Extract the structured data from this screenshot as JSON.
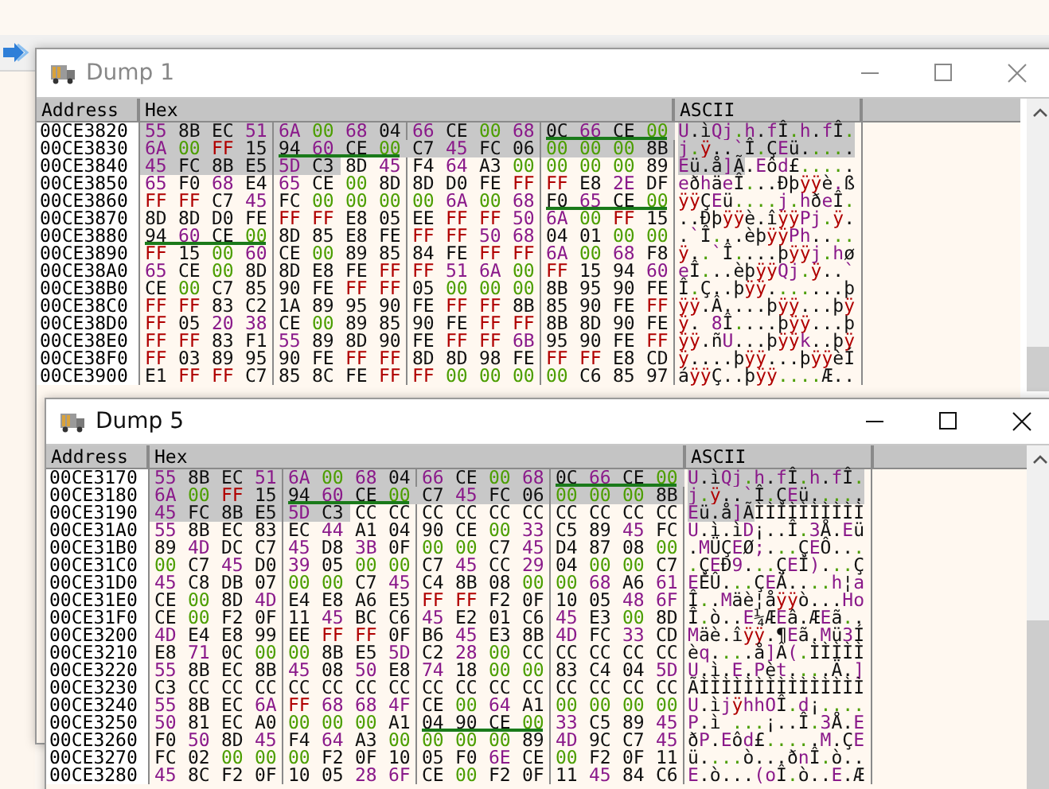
{
  "windows": [
    {
      "title": "Dump 1",
      "active": false,
      "columns": [
        "Address",
        "Hex",
        "ASCII"
      ],
      "rows": [
        {
          "address": "00CE3820",
          "groups": [
            {
              "bytes": "55 8B EC 51",
              "selected": [
                true,
                true,
                true,
                true
              ],
              "underlined": false
            },
            {
              "bytes": "6A 00 68 04",
              "selected": [
                true,
                true,
                true,
                true
              ],
              "underlined": false
            },
            {
              "bytes": "66 CE 00 68",
              "selected": [
                true,
                true,
                true,
                true
              ],
              "underlined": false
            },
            {
              "bytes": "0C 66 CE 00",
              "selected": [
                true,
                true,
                true,
                true
              ],
              "underlined": true
            }
          ],
          "ascii": [
            {
              "text": "U.ìQj.h.fÎ.h.fÎ.",
              "selected": true
            }
          ]
        },
        {
          "address": "00CE3830",
          "groups": [
            {
              "bytes": "6A 00 FF 15",
              "selected": [
                true,
                true,
                true,
                true
              ],
              "underlined": false
            },
            {
              "bytes": "94 60 CE 00",
              "selected": [
                true,
                true,
                true,
                true
              ],
              "underlined": true
            },
            {
              "bytes": "C7 45 FC 06",
              "selected": [
                true,
                true,
                true,
                true
              ],
              "underlined": false
            },
            {
              "bytes": "00 00 00 8B",
              "selected": [
                true,
                true,
                true,
                true
              ],
              "underlined": false
            }
          ],
          "ascii": [
            {
              "text": "j.ÿ..`Î.ÇEü.....",
              "selected": true
            }
          ]
        },
        {
          "address": "00CE3840",
          "groups": [
            {
              "bytes": "45 FC 8B E5",
              "selected": [
                true,
                true,
                true,
                true
              ],
              "underlined": false
            },
            {
              "bytes": "5D C3 8D 45",
              "selected": [
                true,
                true,
                false,
                false
              ],
              "underlined": false
            },
            {
              "bytes": "F4 64 A3 00",
              "selected": [
                false,
                false,
                false,
                false
              ],
              "underlined": false
            },
            {
              "bytes": "00 00 00 89",
              "selected": [
                false,
                false,
                false,
                false
              ],
              "underlined": false
            }
          ],
          "ascii": [
            {
              "text": "Eü.å]Ã",
              "selected": true
            },
            {
              "text": ".Eôd£.....",
              "selected": false
            }
          ]
        },
        {
          "address": "00CE3850",
          "groups": [
            {
              "bytes": "65 F0 68 E4",
              "selected": [
                false,
                false,
                false,
                false
              ],
              "underlined": false
            },
            {
              "bytes": "65 CE 00 8D",
              "selected": [
                false,
                false,
                false,
                false
              ],
              "underlined": false
            },
            {
              "bytes": "8D D0 FE FF",
              "selected": [
                false,
                false,
                false,
                false
              ],
              "underlined": false
            },
            {
              "bytes": "FF E8 2E DF",
              "selected": [
                false,
                false,
                false,
                false
              ],
              "underlined": false
            }
          ],
          "ascii": [
            {
              "text": "eðhäeÎ...Ðþÿÿè.ß",
              "selected": false
            }
          ]
        },
        {
          "address": "00CE3860",
          "groups": [
            {
              "bytes": "FF FF C7 45",
              "selected": [
                false,
                false,
                false,
                false
              ],
              "underlined": false
            },
            {
              "bytes": "FC 00 00 00",
              "selected": [
                false,
                false,
                false,
                false
              ],
              "underlined": false
            },
            {
              "bytes": "00 6A 00 68",
              "selected": [
                false,
                false,
                false,
                false
              ],
              "underlined": false
            },
            {
              "bytes": "F0 65 CE 00",
              "selected": [
                false,
                false,
                false,
                false
              ],
              "underlined": true
            }
          ],
          "ascii": [
            {
              "text": "ÿÿÇEü....j.hðeÎ.",
              "selected": false
            }
          ]
        },
        {
          "address": "00CE3870",
          "groups": [
            {
              "bytes": "8D 8D D0 FE",
              "selected": [
                false,
                false,
                false,
                false
              ],
              "underlined": false
            },
            {
              "bytes": "FF FF E8 05",
              "selected": [
                false,
                false,
                false,
                false
              ],
              "underlined": false
            },
            {
              "bytes": "EE FF FF 50",
              "selected": [
                false,
                false,
                false,
                false
              ],
              "underlined": false
            },
            {
              "bytes": "6A 00 FF 15",
              "selected": [
                false,
                false,
                false,
                false
              ],
              "underlined": false
            }
          ],
          "ascii": [
            {
              "text": "..Ðþÿÿè.îÿÿPj.ÿ.",
              "selected": false
            }
          ]
        },
        {
          "address": "00CE3880",
          "groups": [
            {
              "bytes": "94 60 CE 00",
              "selected": [
                false,
                false,
                false,
                false
              ],
              "underlined": true
            },
            {
              "bytes": "8D 85 E8 FE",
              "selected": [
                false,
                false,
                false,
                false
              ],
              "underlined": false
            },
            {
              "bytes": "FF FF 50 68",
              "selected": [
                false,
                false,
                false,
                false
              ],
              "underlined": false
            },
            {
              "bytes": "04 01 00 00",
              "selected": [
                false,
                false,
                false,
                false
              ],
              "underlined": false
            }
          ],
          "ascii": [
            {
              "text": ".`Î...èþÿÿPh....",
              "selected": false
            }
          ]
        },
        {
          "address": "00CE3890",
          "groups": [
            {
              "bytes": "FF 15 00 60",
              "selected": [
                false,
                false,
                false,
                false
              ],
              "underlined": false
            },
            {
              "bytes": "CE 00 89 85",
              "selected": [
                false,
                false,
                false,
                false
              ],
              "underlined": false
            },
            {
              "bytes": "84 FE FF FF",
              "selected": [
                false,
                false,
                false,
                false
              ],
              "underlined": false
            },
            {
              "bytes": "6A 00 68 F8",
              "selected": [
                false,
                false,
                false,
                false
              ],
              "underlined": false
            }
          ],
          "ascii": [
            {
              "text": "ÿ..`Î....þÿÿj.hø",
              "selected": false
            }
          ]
        },
        {
          "address": "00CE38A0",
          "groups": [
            {
              "bytes": "65 CE 00 8D",
              "selected": [
                false,
                false,
                false,
                false
              ],
              "underlined": false
            },
            {
              "bytes": "8D E8 FE FF",
              "selected": [
                false,
                false,
                false,
                false
              ],
              "underlined": false
            },
            {
              "bytes": "FF 51 6A 00",
              "selected": [
                false,
                false,
                false,
                false
              ],
              "underlined": false
            },
            {
              "bytes": "FF 15 94 60",
              "selected": [
                false,
                false,
                false,
                false
              ],
              "underlined": false
            }
          ],
          "ascii": [
            {
              "text": "eÎ...èþÿÿQj.ÿ..`",
              "selected": false
            }
          ]
        },
        {
          "address": "00CE38B0",
          "groups": [
            {
              "bytes": "CE 00 C7 85",
              "selected": [
                false,
                false,
                false,
                false
              ],
              "underlined": false
            },
            {
              "bytes": "90 FE FF FF",
              "selected": [
                false,
                false,
                false,
                false
              ],
              "underlined": false
            },
            {
              "bytes": "05 00 00 00",
              "selected": [
                false,
                false,
                false,
                false
              ],
              "underlined": false
            },
            {
              "bytes": "8B 95 90 FE",
              "selected": [
                false,
                false,
                false,
                false
              ],
              "underlined": false
            }
          ],
          "ascii": [
            {
              "text": "Î.Ç..þÿÿ.......þ",
              "selected": false
            }
          ]
        },
        {
          "address": "00CE38C0",
          "groups": [
            {
              "bytes": "FF FF 83 C2",
              "selected": [
                false,
                false,
                false,
                false
              ],
              "underlined": false
            },
            {
              "bytes": "1A 89 95 90",
              "selected": [
                false,
                false,
                false,
                false
              ],
              "underlined": false
            },
            {
              "bytes": "FE FF FF 8B",
              "selected": [
                false,
                false,
                false,
                false
              ],
              "underlined": false
            },
            {
              "bytes": "85 90 FE FF",
              "selected": [
                false,
                false,
                false,
                false
              ],
              "underlined": false
            }
          ],
          "ascii": [
            {
              "text": "ÿÿ.Â....þÿÿ...þÿ",
              "selected": false
            }
          ]
        },
        {
          "address": "00CE38D0",
          "groups": [
            {
              "bytes": "FF 05 20 38",
              "selected": [
                false,
                false,
                false,
                false
              ],
              "underlined": false
            },
            {
              "bytes": "CE 00 89 85",
              "selected": [
                false,
                false,
                false,
                false
              ],
              "underlined": false
            },
            {
              "bytes": "90 FE FF FF",
              "selected": [
                false,
                false,
                false,
                false
              ],
              "underlined": false
            },
            {
              "bytes": "8B 8D 90 FE",
              "selected": [
                false,
                false,
                false,
                false
              ],
              "underlined": false
            }
          ],
          "ascii": [
            {
              "text": "ÿ. 8Î....þÿÿ...þ",
              "selected": false
            }
          ]
        },
        {
          "address": "00CE38E0",
          "groups": [
            {
              "bytes": "FF FF 83 F1",
              "selected": [
                false,
                false,
                false,
                false
              ],
              "underlined": false
            },
            {
              "bytes": "55 89 8D 90",
              "selected": [
                false,
                false,
                false,
                false
              ],
              "underlined": false
            },
            {
              "bytes": "FE FF FF 6B",
              "selected": [
                false,
                false,
                false,
                false
              ],
              "underlined": false
            },
            {
              "bytes": "95 90 FE FF",
              "selected": [
                false,
                false,
                false,
                false
              ],
              "underlined": false
            }
          ],
          "ascii": [
            {
              "text": "ÿÿ.ñU...þÿÿk..þÿ",
              "selected": false
            }
          ]
        },
        {
          "address": "00CE38F0",
          "groups": [
            {
              "bytes": "FF 03 89 95",
              "selected": [
                false,
                false,
                false,
                false
              ],
              "underlined": false
            },
            {
              "bytes": "90 FE FF FF",
              "selected": [
                false,
                false,
                false,
                false
              ],
              "underlined": false
            },
            {
              "bytes": "8D 8D 98 FE",
              "selected": [
                false,
                false,
                false,
                false
              ],
              "underlined": false
            },
            {
              "bytes": "FF FF E8 CD",
              "selected": [
                false,
                false,
                false,
                false
              ],
              "underlined": false
            }
          ],
          "ascii": [
            {
              "text": "ÿ....þÿÿ...þÿÿèÍ",
              "selected": false
            }
          ]
        },
        {
          "address": "00CE3900",
          "groups": [
            {
              "bytes": "E1 FF FF C7",
              "selected": [
                false,
                false,
                false,
                false
              ],
              "underlined": false
            },
            {
              "bytes": "85 8C FE FF",
              "selected": [
                false,
                false,
                false,
                false
              ],
              "underlined": false
            },
            {
              "bytes": "FF 00 00 00",
              "selected": [
                false,
                false,
                false,
                false
              ],
              "underlined": false
            },
            {
              "bytes": "00 C6 85 97",
              "selected": [
                false,
                false,
                false,
                false
              ],
              "underlined": false
            }
          ],
          "ascii": [
            {
              "text": "áÿÿÇ..þÿÿ....Æ..",
              "selected": false
            }
          ]
        }
      ]
    },
    {
      "title": "Dump 5",
      "active": true,
      "columns": [
        "Address",
        "Hex",
        "ASCII"
      ],
      "rows": [
        {
          "address": "00CE3170",
          "groups": [
            {
              "bytes": "55 8B EC 51",
              "selected": [
                true,
                true,
                true,
                true
              ],
              "underlined": false
            },
            {
              "bytes": "6A 00 68 04",
              "selected": [
                true,
                true,
                true,
                true
              ],
              "underlined": false
            },
            {
              "bytes": "66 CE 00 68",
              "selected": [
                true,
                true,
                true,
                true
              ],
              "underlined": false
            },
            {
              "bytes": "0C 66 CE 00",
              "selected": [
                true,
                true,
                true,
                true
              ],
              "underlined": true
            }
          ],
          "ascii": [
            {
              "text": "U.ìQj.h.fÎ.h.fÎ.",
              "selected": true
            }
          ]
        },
        {
          "address": "00CE3180",
          "groups": [
            {
              "bytes": "6A 00 FF 15",
              "selected": [
                true,
                true,
                true,
                true
              ],
              "underlined": false
            },
            {
              "bytes": "94 60 CE 00",
              "selected": [
                true,
                true,
                true,
                true
              ],
              "underlined": true
            },
            {
              "bytes": "C7 45 FC 06",
              "selected": [
                true,
                true,
                true,
                true
              ],
              "underlined": false
            },
            {
              "bytes": "00 00 00 8B",
              "selected": [
                true,
                true,
                true,
                true
              ],
              "underlined": false
            }
          ],
          "ascii": [
            {
              "text": "j.ÿ..`Î.ÇEü.....",
              "selected": true
            }
          ]
        },
        {
          "address": "00CE3190",
          "groups": [
            {
              "bytes": "45 FC 8B E5",
              "selected": [
                true,
                true,
                true,
                true
              ],
              "underlined": false
            },
            {
              "bytes": "5D C3 CC CC",
              "selected": [
                true,
                true,
                false,
                false
              ],
              "underlined": false
            },
            {
              "bytes": "CC CC CC CC",
              "selected": [
                false,
                false,
                false,
                false
              ],
              "underlined": false
            },
            {
              "bytes": "CC CC CC CC",
              "selected": [
                false,
                false,
                false,
                false
              ],
              "underlined": false
            }
          ],
          "ascii": [
            {
              "text": "Eü.å]Ã",
              "selected": true
            },
            {
              "text": "ÌÌÌÌÌÌÌÌÌÌ",
              "selected": false
            }
          ]
        },
        {
          "address": "00CE31A0",
          "groups": [
            {
              "bytes": "55 8B EC 83",
              "selected": [
                false,
                false,
                false,
                false
              ],
              "underlined": false
            },
            {
              "bytes": "EC 44 A1 04",
              "selected": [
                false,
                false,
                false,
                false
              ],
              "underlined": false
            },
            {
              "bytes": "90 CE 00 33",
              "selected": [
                false,
                false,
                false,
                false
              ],
              "underlined": false
            },
            {
              "bytes": "C5 89 45 FC",
              "selected": [
                false,
                false,
                false,
                false
              ],
              "underlined": false
            }
          ],
          "ascii": [
            {
              "text": "U.ì.ìD¡..Î.3Å.Eü",
              "selected": false
            }
          ]
        },
        {
          "address": "00CE31B0",
          "groups": [
            {
              "bytes": "89 4D DC C7",
              "selected": [
                false,
                false,
                false,
                false
              ],
              "underlined": false
            },
            {
              "bytes": "45 D8 3B 0F",
              "selected": [
                false,
                false,
                false,
                false
              ],
              "underlined": false
            },
            {
              "bytes": "00 00 C7 45",
              "selected": [
                false,
                false,
                false,
                false
              ],
              "underlined": false
            },
            {
              "bytes": "D4 87 08 00",
              "selected": [
                false,
                false,
                false,
                false
              ],
              "underlined": false
            }
          ],
          "ascii": [
            {
              "text": ".MÜÇEØ;...ÇEÔ...",
              "selected": false
            }
          ]
        },
        {
          "address": "00CE31C0",
          "groups": [
            {
              "bytes": "00 C7 45 D0",
              "selected": [
                false,
                false,
                false,
                false
              ],
              "underlined": false
            },
            {
              "bytes": "39 05 00 00",
              "selected": [
                false,
                false,
                false,
                false
              ],
              "underlined": false
            },
            {
              "bytes": "C7 45 CC 29",
              "selected": [
                false,
                false,
                false,
                false
              ],
              "underlined": false
            },
            {
              "bytes": "04 00 00 C7",
              "selected": [
                false,
                false,
                false,
                false
              ],
              "underlined": false
            }
          ],
          "ascii": [
            {
              "text": ".ÇEÐ9...ÇEÌ)...Ç",
              "selected": false
            }
          ]
        },
        {
          "address": "00CE31D0",
          "groups": [
            {
              "bytes": "45 C8 DB 07",
              "selected": [
                false,
                false,
                false,
                false
              ],
              "underlined": false
            },
            {
              "bytes": "00 00 C7 45",
              "selected": [
                false,
                false,
                false,
                false
              ],
              "underlined": false
            },
            {
              "bytes": "C4 8B 08 00",
              "selected": [
                false,
                false,
                false,
                false
              ],
              "underlined": false
            },
            {
              "bytes": "00 68 A6 61",
              "selected": [
                false,
                false,
                false,
                false
              ],
              "underlined": false
            }
          ],
          "ascii": [
            {
              "text": "EÈÛ...ÇEÄ....h¦a",
              "selected": false
            }
          ]
        },
        {
          "address": "00CE31E0",
          "groups": [
            {
              "bytes": "CE 00 8D 4D",
              "selected": [
                false,
                false,
                false,
                false
              ],
              "underlined": false
            },
            {
              "bytes": "E4 E8 A6 E5",
              "selected": [
                false,
                false,
                false,
                false
              ],
              "underlined": false
            },
            {
              "bytes": "FF FF F2 0F",
              "selected": [
                false,
                false,
                false,
                false
              ],
              "underlined": false
            },
            {
              "bytes": "10 05 48 6F",
              "selected": [
                false,
                false,
                false,
                false
              ],
              "underlined": false
            }
          ],
          "ascii": [
            {
              "text": "Î..Mäè¦åÿÿò...Ho",
              "selected": false
            }
          ]
        },
        {
          "address": "00CE31F0",
          "groups": [
            {
              "bytes": "CE 00 F2 0F",
              "selected": [
                false,
                false,
                false,
                false
              ],
              "underlined": false
            },
            {
              "bytes": "11 45 BC C6",
              "selected": [
                false,
                false,
                false,
                false
              ],
              "underlined": false
            },
            {
              "bytes": "45 E2 01 C6",
              "selected": [
                false,
                false,
                false,
                false
              ],
              "underlined": false
            },
            {
              "bytes": "45 E3 00 8D",
              "selected": [
                false,
                false,
                false,
                false
              ],
              "underlined": false
            }
          ],
          "ascii": [
            {
              "text": "Î.ò..E¼ÆEâ.ÆEã..",
              "selected": false
            }
          ]
        },
        {
          "address": "00CE3200",
          "groups": [
            {
              "bytes": "4D E4 E8 99",
              "selected": [
                false,
                false,
                false,
                false
              ],
              "underlined": false
            },
            {
              "bytes": "EE FF FF 0F",
              "selected": [
                false,
                false,
                false,
                false
              ],
              "underlined": false
            },
            {
              "bytes": "B6 45 E3 8B",
              "selected": [
                false,
                false,
                false,
                false
              ],
              "underlined": false
            },
            {
              "bytes": "4D FC 33 CD",
              "selected": [
                false,
                false,
                false,
                false
              ],
              "underlined": false
            }
          ],
          "ascii": [
            {
              "text": "Mäè.îÿÿ.¶Eã.Mü3Í",
              "selected": false
            }
          ]
        },
        {
          "address": "00CE3210",
          "groups": [
            {
              "bytes": "E8 71 0C 00",
              "selected": [
                false,
                false,
                false,
                false
              ],
              "underlined": false
            },
            {
              "bytes": "00 8B E5 5D",
              "selected": [
                false,
                false,
                false,
                false
              ],
              "underlined": false
            },
            {
              "bytes": "C2 28 00 CC",
              "selected": [
                false,
                false,
                false,
                false
              ],
              "underlined": false
            },
            {
              "bytes": "CC CC CC CC",
              "selected": [
                false,
                false,
                false,
                false
              ],
              "underlined": false
            }
          ],
          "ascii": [
            {
              "text": "èq....å]Â(.ÌÌÌÌÌ",
              "selected": false
            }
          ]
        },
        {
          "address": "00CE3220",
          "groups": [
            {
              "bytes": "55 8B EC 8B",
              "selected": [
                false,
                false,
                false,
                false
              ],
              "underlined": false
            },
            {
              "bytes": "45 08 50 E8",
              "selected": [
                false,
                false,
                false,
                false
              ],
              "underlined": false
            },
            {
              "bytes": "74 18 00 00",
              "selected": [
                false,
                false,
                false,
                false
              ],
              "underlined": false
            },
            {
              "bytes": "83 C4 04 5D",
              "selected": [
                false,
                false,
                false,
                false
              ],
              "underlined": false
            }
          ],
          "ascii": [
            {
              "text": "U.ì.E.Pèt....Ä.]",
              "selected": false
            }
          ]
        },
        {
          "address": "00CE3230",
          "groups": [
            {
              "bytes": "C3 CC CC CC",
              "selected": [
                false,
                false,
                false,
                false
              ],
              "underlined": false
            },
            {
              "bytes": "CC CC CC CC",
              "selected": [
                false,
                false,
                false,
                false
              ],
              "underlined": false
            },
            {
              "bytes": "CC CC CC CC",
              "selected": [
                false,
                false,
                false,
                false
              ],
              "underlined": false
            },
            {
              "bytes": "CC CC CC CC",
              "selected": [
                false,
                false,
                false,
                false
              ],
              "underlined": false
            }
          ],
          "ascii": [
            {
              "text": "ÃÌÌÌÌÌÌÌÌÌÌÌÌÌÌÌ",
              "selected": false
            }
          ]
        },
        {
          "address": "00CE3240",
          "groups": [
            {
              "bytes": "55 8B EC 6A",
              "selected": [
                false,
                false,
                false,
                false
              ],
              "underlined": false
            },
            {
              "bytes": "FF 68 68 4F",
              "selected": [
                false,
                false,
                false,
                false
              ],
              "underlined": false
            },
            {
              "bytes": "CE 00 64 A1",
              "selected": [
                false,
                false,
                false,
                false
              ],
              "underlined": false
            },
            {
              "bytes": "00 00 00 00",
              "selected": [
                false,
                false,
                false,
                false
              ],
              "underlined": false
            }
          ],
          "ascii": [
            {
              "text": "U.ìjÿhhOÎ.d¡....",
              "selected": false
            }
          ]
        },
        {
          "address": "00CE3250",
          "groups": [
            {
              "bytes": "50 81 EC A0",
              "selected": [
                false,
                false,
                false,
                false
              ],
              "underlined": false
            },
            {
              "bytes": "00 00 00 A1",
              "selected": [
                false,
                false,
                false,
                false
              ],
              "underlined": false
            },
            {
              "bytes": "04 90 CE 00",
              "selected": [
                false,
                false,
                false,
                false
              ],
              "underlined": true
            },
            {
              "bytes": "33 C5 89 45",
              "selected": [
                false,
                false,
                false,
                false
              ],
              "underlined": false
            }
          ],
          "ascii": [
            {
              "text": "P.ì ...¡..Î.3Å.E",
              "selected": false
            }
          ]
        },
        {
          "address": "00CE3260",
          "groups": [
            {
              "bytes": "F0 50 8D 45",
              "selected": [
                false,
                false,
                false,
                false
              ],
              "underlined": false
            },
            {
              "bytes": "F4 64 A3 00",
              "selected": [
                false,
                false,
                false,
                false
              ],
              "underlined": false
            },
            {
              "bytes": "00 00 00 89",
              "selected": [
                false,
                false,
                false,
                false
              ],
              "underlined": false
            },
            {
              "bytes": "4D 9C C7 45",
              "selected": [
                false,
                false,
                false,
                false
              ],
              "underlined": false
            }
          ],
          "ascii": [
            {
              "text": "ðP.Eôd£.....M.ÇE",
              "selected": false
            }
          ]
        },
        {
          "address": "00CE3270",
          "groups": [
            {
              "bytes": "FC 02 00 00",
              "selected": [
                false,
                false,
                false,
                false
              ],
              "underlined": false
            },
            {
              "bytes": "00 F2 0F 10",
              "selected": [
                false,
                false,
                false,
                false
              ],
              "underlined": false
            },
            {
              "bytes": "05 F0 6E CE",
              "selected": [
                false,
                false,
                false,
                false
              ],
              "underlined": false
            },
            {
              "bytes": "00 F2 0F 11",
              "selected": [
                false,
                false,
                false,
                false
              ],
              "underlined": false
            }
          ],
          "ascii": [
            {
              "text": "ü....ò...ðnÎ.ò..",
              "selected": false
            }
          ]
        },
        {
          "address": "00CE3280",
          "groups": [
            {
              "bytes": "45 8C F2 0F",
              "selected": [
                false,
                false,
                false,
                false
              ],
              "underlined": false
            },
            {
              "bytes": "10 05 28 6F",
              "selected": [
                false,
                false,
                false,
                false
              ],
              "underlined": false
            },
            {
              "bytes": "CE 00 F2 0F",
              "selected": [
                false,
                false,
                false,
                false
              ],
              "underlined": false
            },
            {
              "bytes": "11 45 84 C6",
              "selected": [
                false,
                false,
                false,
                false
              ],
              "underlined": false
            }
          ],
          "ascii": [
            {
              "text": "E.ò...(oÎ.ò..E.Æ",
              "selected": false
            }
          ]
        }
      ]
    }
  ]
}
